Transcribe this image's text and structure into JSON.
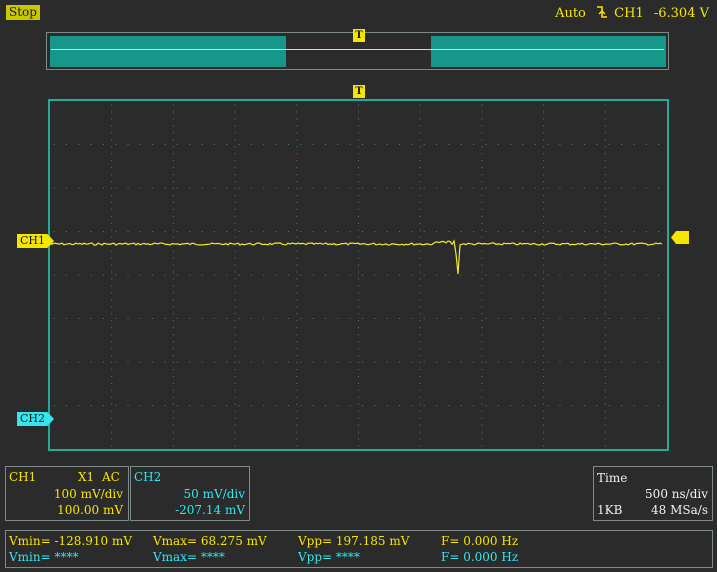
{
  "status": {
    "run_state": "Stop"
  },
  "trigger": {
    "mode": "Auto",
    "source": "CH1",
    "level": "-6.304 V",
    "marker_label": "T"
  },
  "markers": {
    "ch1": "CH1",
    "ch2": "CH2"
  },
  "ch1_panel": {
    "name": "CH1",
    "probe": "X1",
    "coupling": "AC",
    "scale": "100 mV/div",
    "offset": "100.00 mV"
  },
  "ch2_panel": {
    "name": "CH2",
    "scale": "50 mV/div",
    "offset": "-207.14 mV"
  },
  "time_panel": {
    "title": "Time",
    "timebase": "500 ns/div",
    "memory": "1KB",
    "sample_rate": "48 MSa/s"
  },
  "measurements": {
    "row1": {
      "vmin": "Vmin= -128.910 mV",
      "vmax": "Vmax= 68.275 mV",
      "vpp": "Vpp= 197.185 mV",
      "freq": "F= 0.000 Hz"
    },
    "row2": {
      "vmin": "Vmin= ****",
      "vmax": "Vmax= ****",
      "vpp": "Vpp= ****",
      "freq": "F= 0.000 Hz"
    }
  },
  "colors": {
    "ch1": "#f5e600",
    "ch2": "#33e6f0",
    "grid_border": "#27a99a",
    "background": "#2b2b2b"
  },
  "icons": {
    "trigger_edge": "falling-edge-trigger-icon"
  }
}
